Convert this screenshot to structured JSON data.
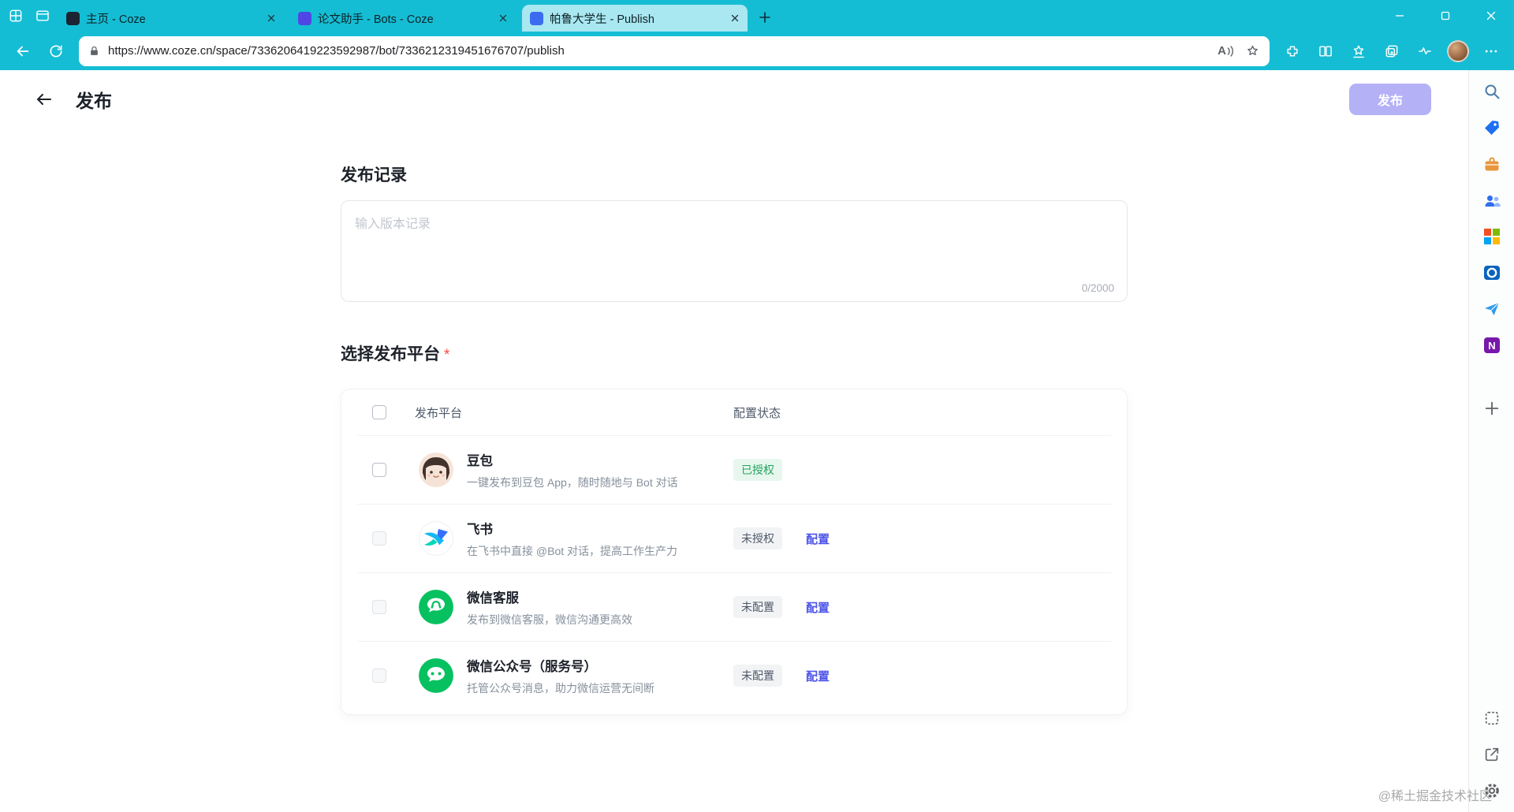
{
  "browser": {
    "tabs": [
      {
        "title": "主页 - Coze",
        "favicon_color": "#1c2433"
      },
      {
        "title": "论文助手 - Bots - Coze",
        "favicon_color": "#4f46e5"
      },
      {
        "title": "帕鲁大学生 - Publish",
        "favicon_color": "#3b6cf0"
      }
    ],
    "active_tab": 2,
    "url": "https://www.coze.cn/space/7336206419223592987/bot/7336212319451676707/publish",
    "read_aloud_glyph": "A"
  },
  "page": {
    "header": {
      "title": "发布",
      "publish_button": "发布"
    },
    "publish_record": {
      "heading": "发布记录",
      "placeholder": "输入版本记录",
      "counter": "0/2000"
    },
    "platforms": {
      "heading": "选择发布平台",
      "required_mark": "*",
      "col_platform": "发布平台",
      "col_status": "配置状态",
      "rows": [
        {
          "name": "豆包",
          "desc": "一键发布到豆包 App，随时随地与 Bot 对话",
          "status": "已授权",
          "status_type": "success",
          "action": "",
          "icon": "doubao",
          "checkbox_enabled": true
        },
        {
          "name": "飞书",
          "desc": "在飞书中直接 @Bot 对话，提高工作生产力",
          "status": "未授权",
          "status_type": "neutral",
          "action": "配置",
          "icon": "feishu",
          "checkbox_enabled": false
        },
        {
          "name": "微信客服",
          "desc": "发布到微信客服，微信沟通更高效",
          "status": "未配置",
          "status_type": "neutral",
          "action": "配置",
          "icon": "wechat-kf",
          "checkbox_enabled": false
        },
        {
          "name": "微信公众号（服务号）",
          "desc": "托管公众号消息，助力微信运营无间断",
          "status": "未配置",
          "status_type": "neutral",
          "action": "配置",
          "icon": "wechat-mp",
          "checkbox_enabled": false
        }
      ]
    }
  },
  "watermark": "@稀土掘金技术社区",
  "colors": {
    "titlebar": "#15bdd4",
    "active_tab": "#a9e7f1",
    "publish_button_disabled": "#b5b1f6",
    "link": "#4d53e8",
    "success_bg": "#e8f7ee",
    "success_text": "#20a45f",
    "neutral_bg": "#f2f3f5",
    "neutral_text": "#4e5969",
    "wechat_green": "#07c160"
  },
  "icons": {
    "sidebar": [
      "search-icon",
      "shopping-icon",
      "tools-icon",
      "people-icon",
      "m365-icon",
      "outlook-icon",
      "drop-icon",
      "onenote-icon",
      "plus-icon",
      "web-capture-icon",
      "open-external-icon",
      "settings-gear-icon"
    ],
    "navbar": [
      "back-icon",
      "refresh-icon",
      "lock-icon",
      "read-aloud-icon",
      "bookmark-star-icon",
      "extensions-icon",
      "split-screen-icon",
      "favorites-icon",
      "collections-icon",
      "browser-essentials-icon",
      "more-icon"
    ]
  }
}
